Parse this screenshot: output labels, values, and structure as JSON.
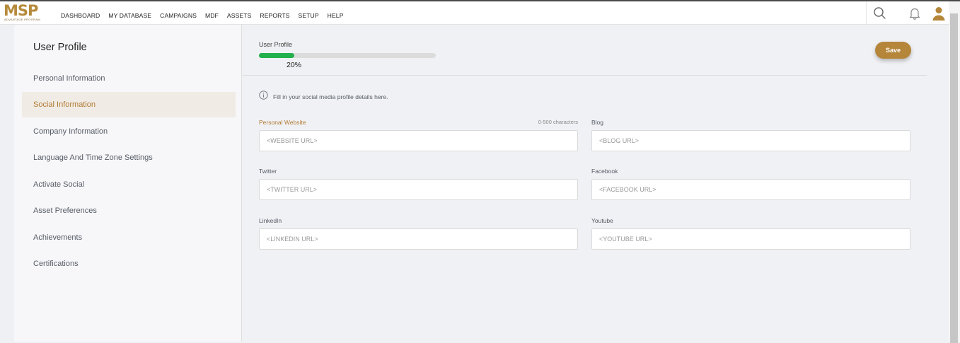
{
  "header": {
    "logo_text": "MSP",
    "logo_subtitle": "ADVANTAGE PROGRAM",
    "nav": [
      "DASHBOARD",
      "MY DATABASE",
      "CAMPAIGNS",
      "MDF",
      "ASSETS",
      "REPORTS",
      "SETUP",
      "HELP"
    ],
    "icons": [
      "search-icon",
      "bell-icon",
      "user-avatar-icon"
    ]
  },
  "sidebar": {
    "title": "User Profile",
    "items": [
      {
        "label": "Personal Information"
      },
      {
        "label": "Social Information",
        "active": true
      },
      {
        "label": "Company Information"
      },
      {
        "label": "Language And Time Zone Settings"
      },
      {
        "label": "Activate Social"
      },
      {
        "label": "Asset Preferences"
      },
      {
        "label": "Achievements"
      },
      {
        "label": "Certifications"
      }
    ]
  },
  "progress": {
    "label": "User Profile",
    "percent": 20,
    "percent_text": "20%"
  },
  "save_label": "Save",
  "info_text": "Fill in your social media profile details here.",
  "fields": {
    "website": {
      "label": "Personal Website",
      "hint": "0-500 characters",
      "placeholder": "<WEBSITE URL>",
      "value": ""
    },
    "blog": {
      "label": "Blog",
      "placeholder": "<BLOG URL>",
      "value": ""
    },
    "twitter": {
      "label": "Twitter",
      "placeholder": "<TWITTER URL>",
      "value": ""
    },
    "facebook": {
      "label": "Facebook",
      "placeholder": "<FACEBOOK URL>",
      "value": ""
    },
    "linkedin": {
      "label": "LinkedIn",
      "placeholder": "<LINKEDIN URL>",
      "value": ""
    },
    "youtube": {
      "label": "Youtube",
      "placeholder": "<YOUTUBE URL>",
      "value": ""
    }
  },
  "colors": {
    "accent": "#b58539",
    "active_text": "#b07a33",
    "active_bg": "#f0ebe4",
    "progress": "#22b14c"
  }
}
